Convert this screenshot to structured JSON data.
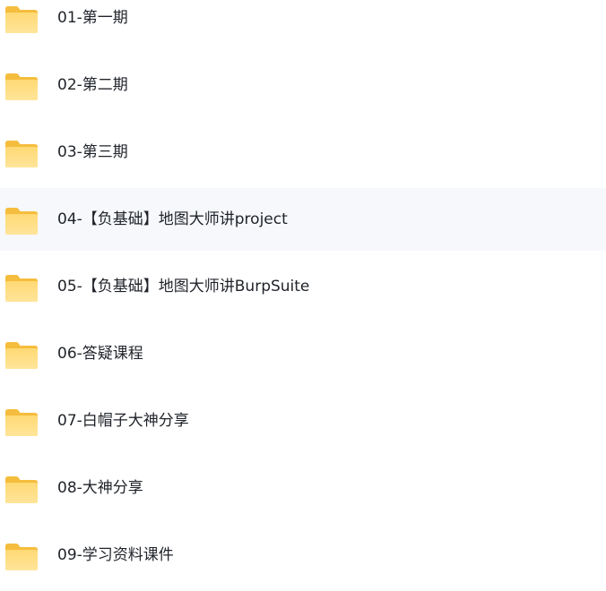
{
  "folders": [
    {
      "name": "01-第一期",
      "icon": "folder-icon",
      "hovered": false
    },
    {
      "name": "02-第二期",
      "icon": "folder-icon",
      "hovered": false
    },
    {
      "name": "03-第三期",
      "icon": "folder-icon",
      "hovered": false
    },
    {
      "name": "04-【负基础】地图大师讲project",
      "icon": "folder-icon",
      "hovered": true
    },
    {
      "name": "05-【负基础】地图大师讲BurpSuite",
      "icon": "folder-icon",
      "hovered": false
    },
    {
      "name": "06-答疑课程",
      "icon": "folder-icon",
      "hovered": false
    },
    {
      "name": "07-白帽子大神分享",
      "icon": "folder-icon",
      "hovered": false
    },
    {
      "name": "08-大神分享",
      "icon": "folder-icon",
      "hovered": false
    },
    {
      "name": "09-学习资料课件",
      "icon": "folder-icon",
      "hovered": false
    }
  ],
  "colors": {
    "folder_back": "#f5bd3d",
    "folder_front": "#ffd974",
    "folder_front_light": "#ffe59a",
    "hover_background": "#f6f8fb",
    "text": "#1f2329"
  }
}
